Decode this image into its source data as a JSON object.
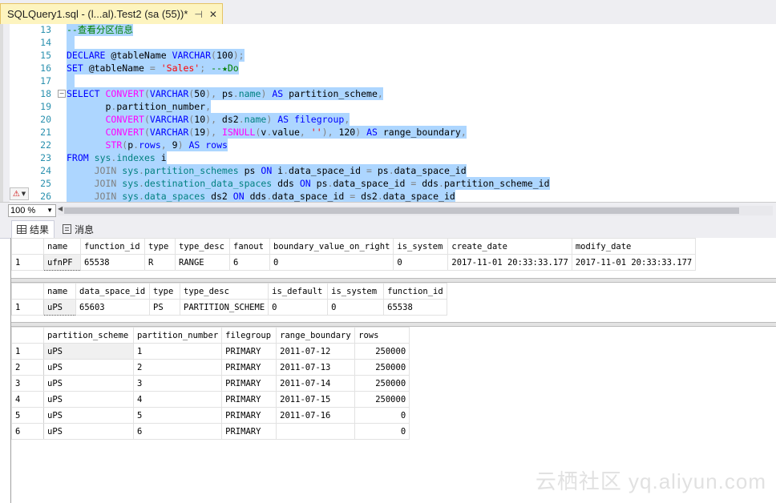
{
  "tab": {
    "title": "SQLQuery1.sql - (l...al).Test2 (sa (55))*",
    "pin": "⊣",
    "close": "✕"
  },
  "editor": {
    "lines": [
      {
        "n": "13",
        "segs": [
          [
            "cm",
            "--查看分区信息"
          ]
        ]
      },
      {
        "n": "14",
        "segs": []
      },
      {
        "n": "15",
        "segs": [
          [
            "kw",
            "DECLARE"
          ],
          [
            "",
            " @tableName "
          ],
          [
            "kw",
            "VARCHAR"
          ],
          [
            "op",
            "("
          ],
          [
            "",
            "100"
          ],
          [
            "op",
            ");"
          ]
        ]
      },
      {
        "n": "16",
        "segs": [
          [
            "kw",
            "SET"
          ],
          [
            "",
            " @tableName "
          ],
          [
            "op",
            "="
          ],
          [
            "",
            " "
          ],
          [
            "str",
            "'Sales'"
          ],
          [
            "op",
            ";"
          ],
          [
            "",
            " "
          ],
          [
            "cm",
            "--★Do"
          ]
        ]
      },
      {
        "n": "17",
        "segs": []
      },
      {
        "n": "18",
        "fold": "−",
        "segs": [
          [
            "kw",
            "SELECT"
          ],
          [
            "",
            " "
          ],
          [
            "fn",
            "CONVERT"
          ],
          [
            "op",
            "("
          ],
          [
            "kw",
            "VARCHAR"
          ],
          [
            "op",
            "("
          ],
          [
            "",
            "50"
          ],
          [
            "op",
            "),"
          ],
          [
            "",
            " ps"
          ],
          [
            "op",
            "."
          ],
          [
            "sy",
            "name"
          ],
          [
            "op",
            ")"
          ],
          [
            "",
            " "
          ],
          [
            "kw",
            "AS"
          ],
          [
            "",
            " partition_scheme"
          ],
          [
            "op",
            ","
          ]
        ]
      },
      {
        "n": "19",
        "segs": [
          [
            "",
            "       p"
          ],
          [
            "op",
            "."
          ],
          [
            "",
            "partition_number"
          ],
          [
            "op",
            ","
          ]
        ]
      },
      {
        "n": "20",
        "segs": [
          [
            "",
            "       "
          ],
          [
            "fn",
            "CONVERT"
          ],
          [
            "op",
            "("
          ],
          [
            "kw",
            "VARCHAR"
          ],
          [
            "op",
            "("
          ],
          [
            "",
            "10"
          ],
          [
            "op",
            "),"
          ],
          [
            "",
            " ds2"
          ],
          [
            "op",
            "."
          ],
          [
            "sy",
            "name"
          ],
          [
            "op",
            ")"
          ],
          [
            "",
            " "
          ],
          [
            "kw",
            "AS"
          ],
          [
            "",
            " "
          ],
          [
            "kw",
            "filegroup"
          ],
          [
            "op",
            ","
          ]
        ]
      },
      {
        "n": "21",
        "segs": [
          [
            "",
            "       "
          ],
          [
            "fn",
            "CONVERT"
          ],
          [
            "op",
            "("
          ],
          [
            "kw",
            "VARCHAR"
          ],
          [
            "op",
            "("
          ],
          [
            "",
            "19"
          ],
          [
            "op",
            "),"
          ],
          [
            "",
            " "
          ],
          [
            "fn",
            "ISNULL"
          ],
          [
            "op",
            "("
          ],
          [
            "",
            "v"
          ],
          [
            "op",
            "."
          ],
          [
            "",
            "value"
          ],
          [
            "op",
            ","
          ],
          [
            "",
            " "
          ],
          [
            "str",
            "''"
          ],
          [
            "op",
            "),"
          ],
          [
            "",
            " 120"
          ],
          [
            "op",
            ")"
          ],
          [
            "",
            " "
          ],
          [
            "kw",
            "AS"
          ],
          [
            "",
            " range_boundary"
          ],
          [
            "op",
            ","
          ]
        ]
      },
      {
        "n": "22",
        "segs": [
          [
            "",
            "       "
          ],
          [
            "fn",
            "STR"
          ],
          [
            "op",
            "("
          ],
          [
            "",
            "p"
          ],
          [
            "op",
            "."
          ],
          [
            "kw",
            "rows"
          ],
          [
            "op",
            ","
          ],
          [
            "",
            " 9"
          ],
          [
            "op",
            ")"
          ],
          [
            "",
            " "
          ],
          [
            "kw",
            "AS"
          ],
          [
            "",
            " "
          ],
          [
            "kw",
            "rows"
          ]
        ]
      },
      {
        "n": "23",
        "segs": [
          [
            "kw",
            "FROM"
          ],
          [
            "",
            " "
          ],
          [
            "sy",
            "sys"
          ],
          [
            "op",
            "."
          ],
          [
            "sy",
            "indexes"
          ],
          [
            "",
            " i"
          ]
        ]
      },
      {
        "n": "24",
        "segs": [
          [
            "",
            "     "
          ],
          [
            "gr",
            "JOIN"
          ],
          [
            "",
            " "
          ],
          [
            "sy",
            "sys"
          ],
          [
            "op",
            "."
          ],
          [
            "sy",
            "partition_schemes"
          ],
          [
            "",
            " ps "
          ],
          [
            "kw",
            "ON"
          ],
          [
            "",
            " i"
          ],
          [
            "op",
            "."
          ],
          [
            "",
            "data_space_id "
          ],
          [
            "op",
            "="
          ],
          [
            "",
            " ps"
          ],
          [
            "op",
            "."
          ],
          [
            "",
            "data_space_id"
          ]
        ]
      },
      {
        "n": "25",
        "segs": [
          [
            "",
            "     "
          ],
          [
            "gr",
            "JOIN"
          ],
          [
            "",
            " "
          ],
          [
            "sy",
            "sys"
          ],
          [
            "op",
            "."
          ],
          [
            "sy",
            "destination_data_spaces"
          ],
          [
            "",
            " dds "
          ],
          [
            "kw",
            "ON"
          ],
          [
            "",
            " ps"
          ],
          [
            "op",
            "."
          ],
          [
            "",
            "data_space_id "
          ],
          [
            "op",
            "="
          ],
          [
            "",
            " dds"
          ],
          [
            "op",
            "."
          ],
          [
            "",
            "partition_scheme_id"
          ]
        ]
      },
      {
        "n": "26",
        "segs": [
          [
            "",
            "     "
          ],
          [
            "gr",
            "JOIN"
          ],
          [
            "",
            " "
          ],
          [
            "sy",
            "sys"
          ],
          [
            "op",
            "."
          ],
          [
            "sy",
            "data_spaces"
          ],
          [
            "",
            " ds2 "
          ],
          [
            "kw",
            "ON"
          ],
          [
            "",
            " dds"
          ],
          [
            "op",
            "."
          ],
          [
            "",
            "data_space_id "
          ],
          [
            "op",
            "="
          ],
          [
            "",
            " ds2"
          ],
          [
            "op",
            "."
          ],
          [
            "",
            "data_space_id"
          ]
        ]
      }
    ]
  },
  "status": {
    "zoom": "100 %"
  },
  "results_tabs": [
    {
      "label": "结果"
    },
    {
      "label": "消息"
    }
  ],
  "grids": [
    {
      "columns": [
        "name",
        "function_id",
        "type",
        "type_desc",
        "fanout",
        "boundary_value_on_right",
        "is_system",
        "create_date",
        "modify_date"
      ],
      "widths": [
        46,
        80,
        38,
        68,
        50,
        152,
        68,
        152,
        152
      ],
      "rows": [
        [
          "1",
          "ufnPF",
          "65538",
          "R",
          "RANGE",
          "6",
          "0",
          "0",
          "2017-11-01 20:33:33.177",
          "2017-11-01 20:33:33.177"
        ]
      ],
      "right": []
    },
    {
      "columns": [
        "name",
        "data_space_id",
        "type",
        "type_desc",
        "is_default",
        "is_system",
        "function_id"
      ],
      "widths": [
        40,
        92,
        38,
        110,
        74,
        70,
        76
      ],
      "rows": [
        [
          "1",
          "uPS",
          "65603",
          "PS",
          "PARTITION_SCHEME",
          "0",
          "0",
          "65538"
        ]
      ],
      "right": []
    },
    {
      "columns": [
        "partition_scheme",
        "partition_number",
        "filegroup",
        "range_boundary",
        "rows"
      ],
      "widths": [
        112,
        110,
        68,
        98,
        68
      ],
      "rows": [
        [
          "1",
          "uPS",
          "1",
          "PRIMARY",
          "2011-07-12",
          "250000"
        ],
        [
          "2",
          "uPS",
          "2",
          "PRIMARY",
          "2011-07-13",
          "250000"
        ],
        [
          "3",
          "uPS",
          "3",
          "PRIMARY",
          "2011-07-14",
          "250000"
        ],
        [
          "4",
          "uPS",
          "4",
          "PRIMARY",
          "2011-07-15",
          "250000"
        ],
        [
          "5",
          "uPS",
          "5",
          "PRIMARY",
          "2011-07-16",
          "0"
        ],
        [
          "6",
          "uPS",
          "6",
          "PRIMARY",
          "",
          "0"
        ]
      ],
      "right": [
        4
      ]
    }
  ],
  "watermark": "云栖社区 yq.aliyun.com"
}
